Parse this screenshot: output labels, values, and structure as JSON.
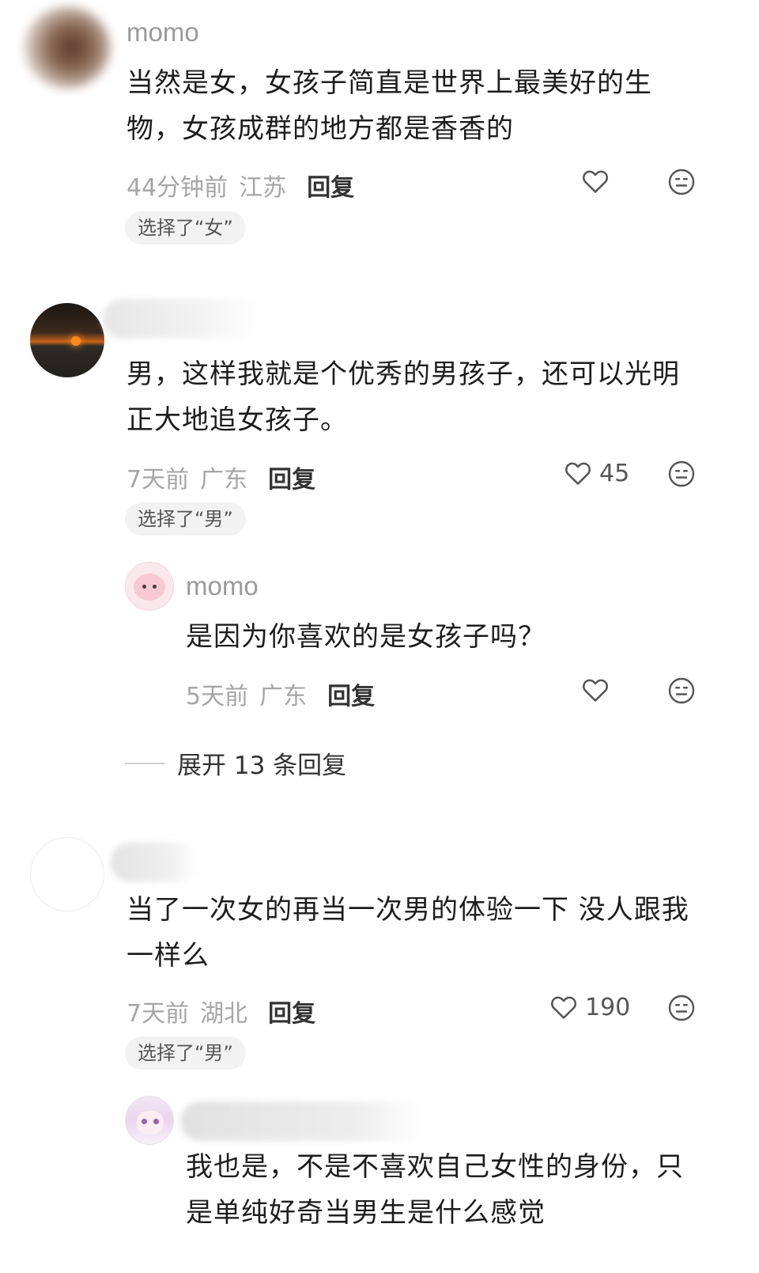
{
  "comments": [
    {
      "username": "momo",
      "text_line1": "当然是女，女孩子简直是世界上最美好的生",
      "text_line2": "物，女孩成群的地方都是香香的",
      "time": "44分钟前",
      "region": "江苏",
      "reply_label": "回复",
      "likes": "",
      "choice_tag": "选择了“女”"
    },
    {
      "username": "",
      "text_line1": "男，这样我就是个优秀的男孩子，还可以光明",
      "text_line2": "正大地追女孩子。",
      "time": "7天前",
      "region": "广东",
      "reply_label": "回复",
      "likes": "45",
      "choice_tag": "选择了“男”",
      "reply": {
        "username": "momo",
        "text": "是因为你喜欢的是女孩子吗？",
        "time": "5天前",
        "region": "广东",
        "reply_label": "回复",
        "likes": ""
      },
      "expand_label": "展开 13 条回复"
    },
    {
      "username": "",
      "text_line1": "当了一次女的再当一次男的体验一下 没人跟我",
      "text_line2": "一样么",
      "time": "7天前",
      "region": "湖北",
      "reply_label": "回复",
      "likes": "190",
      "choice_tag": "选择了“男”",
      "reply": {
        "username": "",
        "text_line1": "我也是，不是不喜欢自己女性的身份，只",
        "text_line2": "是单纯好奇当男生是什么感觉"
      }
    }
  ],
  "icons": {
    "like": "heart-outline-icon",
    "dislike": "meh-face-icon"
  },
  "colors": {
    "meta_gray": "#a6a6a6",
    "tag_bg": "#f2f2f2",
    "text": "#1d1d1d"
  }
}
